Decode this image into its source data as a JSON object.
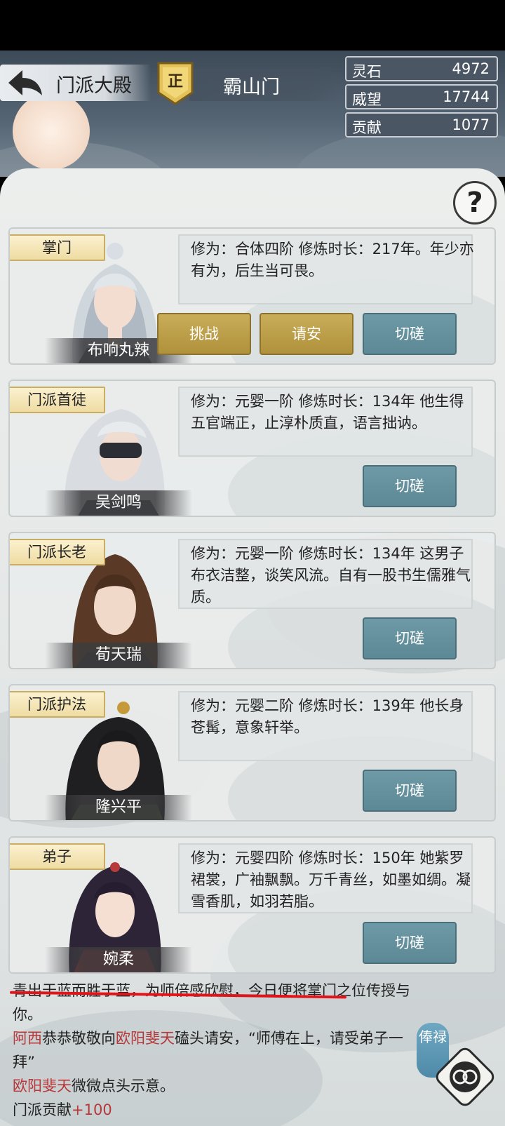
{
  "header": {
    "back_label": "门派大殿",
    "rank_badge": "正",
    "sect_name": "霸山门"
  },
  "stats": [
    {
      "label": "灵石",
      "value": "4972"
    },
    {
      "label": "威望",
      "value": "17744"
    },
    {
      "label": "贡献",
      "value": "1077"
    }
  ],
  "help": "?",
  "cards": [
    {
      "role": "掌门",
      "name": "布响丸辣",
      "desc": "修为：合体四阶 修炼时长：217年。年少亦有为，后生当可畏。",
      "buttons": [
        "挑战",
        "请安",
        "切磋"
      ]
    },
    {
      "role": "门派首徒",
      "name": "吴剑鸣",
      "desc": "修为：元婴一阶 修炼时长：134年 他生得五官端正，止淳朴质直，语言拙讷。",
      "buttons": [
        "切磋"
      ]
    },
    {
      "role": "门派长老",
      "name": "荀天瑞",
      "desc": "修为：元婴一阶 修炼时长：134年 这男子布衣洁整，谈笑风流。自有一股书生儒雅气质。",
      "buttons": [
        "切磋"
      ]
    },
    {
      "role": "门派护法",
      "name": "隆兴平",
      "desc": "修为：元婴二阶 修炼时长：139年 他长身苍髯，意象轩举。",
      "buttons": [
        "切磋"
      ]
    },
    {
      "role": "弟子",
      "name": "婉柔",
      "desc": "修为：元婴四阶 修炼时长：150年 她紫罗裙裳，广袖飘飘。万千青丝，如墨如绸。凝雪香肌，如羽若脂。",
      "buttons": [
        "切磋"
      ]
    }
  ],
  "log": {
    "line1": "青出于蓝而胜于蓝，为师倍感欣慰，今日便将掌门之位传授与你。",
    "l2_name1": "阿西",
    "l2_mid": "恭恭敬敬向",
    "l2_name2": "欧阳斐天",
    "l2_end": "磕头请安，“师傅在上，请受弟子一拜”",
    "l3_name": "欧阳斐天",
    "l3_end": "微微点头示意。",
    "l4_label": "门派贡献",
    "l4_value": "+100"
  },
  "salary_badge": "俸禄",
  "colors": {
    "gold_button": "#b9993f",
    "teal_button": "#659199",
    "log_highlight": "#b7383a",
    "underline": "#e0151b"
  }
}
